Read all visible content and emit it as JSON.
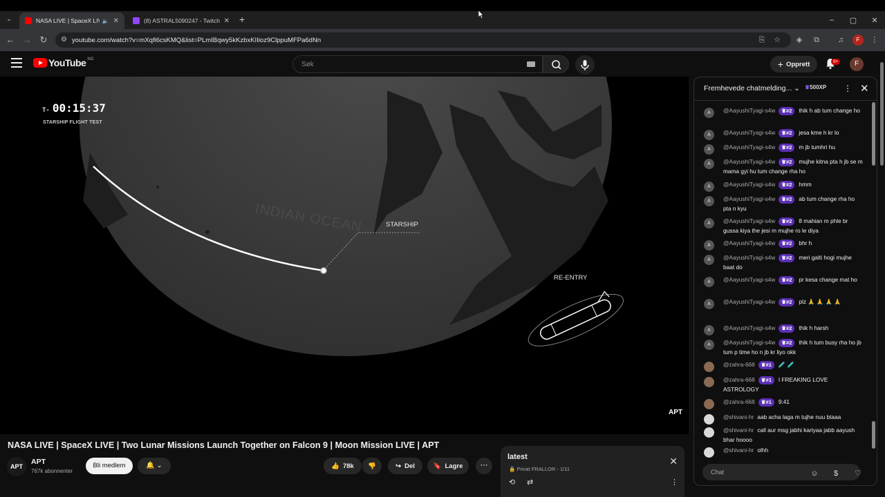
{
  "browser": {
    "tabs": [
      {
        "title": "NASA LIVE | SpaceX LIVE | T",
        "active": true,
        "favicon_color": "#ff0000"
      },
      {
        "title": "(8) ASTRAL5090247 - Twitch",
        "active": false,
        "favicon_color": "#9146ff"
      }
    ],
    "new_tab": "+",
    "window_controls": {
      "minimize": "–",
      "maximize": "▢",
      "close": "✕"
    },
    "url": "youtube.com/watch?v=mXqfi6csKMQ&list=PLmIBqwy5kKzbxKIIioz9ClppuMFPa6dNn"
  },
  "youtube": {
    "logo_text": "YouTube",
    "country_code": "NO",
    "search_placeholder": "Søk",
    "create_label": "Opprett",
    "notification_badge": "9+",
    "avatar_letter": "F"
  },
  "video": {
    "countdown_prefix": "T-",
    "countdown": "00:15:37",
    "flight_label": "STARSHIP FLIGHT TEST",
    "ocean_label": "INDIAN OCEAN",
    "starship_label": "STARSHIP",
    "reentry_label": "RE-ENTRY",
    "watermark": "APT"
  },
  "info": {
    "title": "NASA LIVE | SpaceX LIVE | Two Lunar Missions Launch Together on Falcon 9 | Moon Mission LIVE | APT",
    "channel_logo": "APT",
    "channel_name": "APT",
    "subscribers": "767k abonnenter",
    "join_label": "Bli medlem",
    "likes": "78k",
    "share_label": "Del",
    "save_label": "Lagre"
  },
  "playlist": {
    "title": "latest",
    "meta": "Privat  FRALLOR - 1/11"
  },
  "chat": {
    "header": "Fremhevede chatmelding...",
    "xp": "500XP",
    "input_placeholder": "Chat",
    "rank_color": "#5a2fb5",
    "messages": [
      {
        "user": "@AayushiTyagi-s4w",
        "rank": "#2",
        "text": "thik h ab tum change ho",
        "avatar": "A",
        "avatar_type": "a"
      },
      {
        "user": "@AayushiTyagi-s4w",
        "rank": "#2",
        "text": "jesa kme h kr lo",
        "avatar": "A",
        "avatar_type": "a"
      },
      {
        "user": "@AayushiTyagi-s4w",
        "rank": "#2",
        "text": "m jb tumhri hu",
        "avatar": "A",
        "avatar_type": "a"
      },
      {
        "user": "@AayushiTyagi-s4w",
        "rank": "#2",
        "text": "mujhe kitna pta h jb se m mama gyi hu tum change rha ho",
        "avatar": "A",
        "avatar_type": "a"
      },
      {
        "user": "@AayushiTyagi-s4w",
        "rank": "#2",
        "text": "hmm",
        "avatar": "A",
        "avatar_type": "a"
      },
      {
        "user": "@AayushiTyagi-s4w",
        "rank": "#2",
        "text": "ab tum change rha ho pta n kyu",
        "avatar": "A",
        "avatar_type": "a"
      },
      {
        "user": "@AayushiTyagi-s4w",
        "rank": "#2",
        "text": "8 mahian m phle br gussa kiya the jesi m mujhe ro le diya",
        "avatar": "A",
        "avatar_type": "a"
      },
      {
        "user": "@AayushiTyagi-s4w",
        "rank": "#2",
        "text": "bhr h",
        "avatar": "A",
        "avatar_type": "a"
      },
      {
        "user": "@AayushiTyagi-s4w",
        "rank": "#2",
        "text": "meri galti hogi mujhe baat do",
        "avatar": "A",
        "avatar_type": "a"
      },
      {
        "user": "@AayushiTyagi-s4w",
        "rank": "#2",
        "text": "pr kesa change mat ho",
        "avatar": "A",
        "avatar_type": "a"
      },
      {
        "user": "@AayushiTyagi-s4w",
        "rank": "#2",
        "text": "plz 🙏 🙏 🙏 🙏",
        "avatar": "A",
        "avatar_type": "a"
      },
      {
        "user": "@AayushiTyagi-s4w",
        "rank": "#2",
        "text": "thik h harsh",
        "avatar": "A",
        "avatar_type": "a"
      },
      {
        "user": "@AayushiTyagi-s4w",
        "rank": "#2",
        "text": "thik h tum busy rha ho jb tum p time ho n jb kr liyo okk",
        "avatar": "A",
        "avatar_type": "a"
      },
      {
        "user": "@zahra-668",
        "rank": "#1",
        "text": "🧪 🧪",
        "avatar": "",
        "avatar_type": "z"
      },
      {
        "user": "@zahra-668",
        "rank": "#1",
        "text": "I FREAKING LOVE ASTROLOGY",
        "avatar": "",
        "avatar_type": "z"
      },
      {
        "user": "@zahra-668",
        "rank": "#1",
        "text": "9:41",
        "avatar": "",
        "avatar_type": "z"
      },
      {
        "user": "@shivani-hr",
        "rank": "",
        "text": "aab acha laga m tujhe nuu btaaa",
        "avatar": "",
        "avatar_type": "s"
      },
      {
        "user": "@shivani-hr",
        "rank": "",
        "text": "call aur msg jabhi kariyaa jabb aayush bhar hoooo",
        "avatar": "",
        "avatar_type": "s"
      },
      {
        "user": "@shivani-hr",
        "rank": "",
        "text": "olhh",
        "avatar": "",
        "avatar_type": "s"
      }
    ]
  }
}
